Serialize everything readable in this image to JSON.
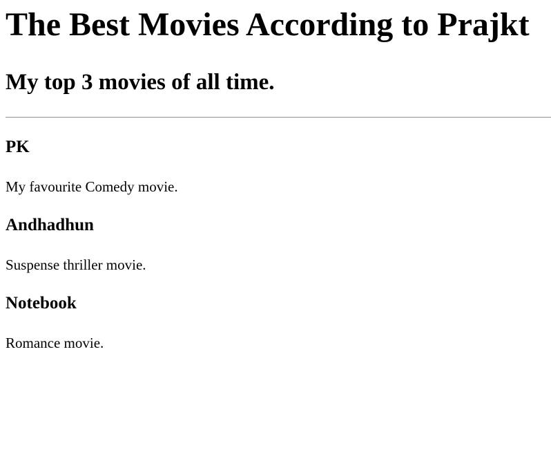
{
  "page": {
    "title": "The Best Movies According to Prajkt",
    "subtitle": "My top 3 movies of all time."
  },
  "movies": [
    {
      "title": "PK",
      "description": "My favourite Comedy movie."
    },
    {
      "title": "Andhadhun",
      "description": "Suspense thriller movie."
    },
    {
      "title": "Notebook",
      "description": "Romance movie."
    }
  ]
}
